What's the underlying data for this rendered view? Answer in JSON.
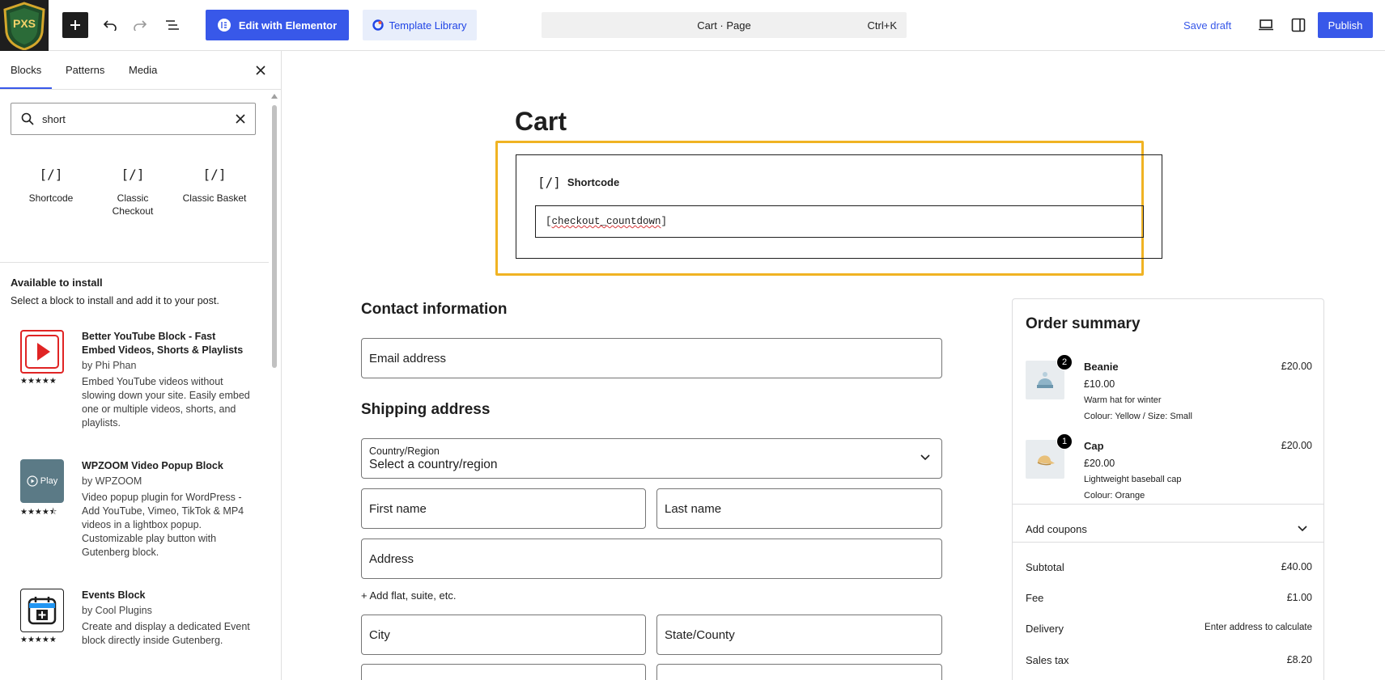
{
  "topbar": {
    "logo_text": "PXS",
    "edit_elementor_label": "Edit with Elementor",
    "template_library_label": "Template Library",
    "command_title": "Cart · Page",
    "command_shortcut": "Ctrl+K",
    "save_draft_label": "Save draft",
    "publish_label": "Publish",
    "accent_color": "#3858e9"
  },
  "sidebar": {
    "tabs": [
      "Blocks",
      "Patterns",
      "Media"
    ],
    "search_value": "short",
    "block_results": [
      {
        "icon": "[/]",
        "label": "Shortcode"
      },
      {
        "icon": "[/]",
        "label": "Classic Checkout"
      },
      {
        "icon": "[/]",
        "label": "Classic Basket"
      }
    ],
    "available_title": "Available to install",
    "available_subtitle": "Select a block to install and add it to your post.",
    "plugins": [
      {
        "name": "Better YouTube Block - Fast Embed Videos, Shorts & Playlists",
        "author": "by Phi Phan",
        "rating": 5,
        "stars": "★★★★★",
        "description": "Embed YouTube videos without slowing down your site. Easily embed one or multiple videos, shorts, and playlists."
      },
      {
        "name": "WPZOOM Video Popup Block",
        "author": "by WPZOOM",
        "rating": 4.5,
        "stars": "★★★★⯪",
        "icon_text": "Play",
        "description": "Video popup plugin for WordPress - Add YouTube, Vimeo, TikTok & MP4 videos in a lightbox popup. Customizable play button with Gutenberg block."
      },
      {
        "name": "Events Block",
        "author": "by Cool Plugins",
        "rating": 5,
        "stars": "★★★★★",
        "description": "Create and display a dedicated Event block directly inside Gutenberg."
      }
    ]
  },
  "canvas": {
    "page_title": "Cart",
    "shortcode_block": {
      "label": "Shortcode",
      "icon": "[/]",
      "value_prefix": "[",
      "value_word": "checkout_countdown",
      "value_suffix": "]"
    },
    "contact_title": "Contact information",
    "email_placeholder": "Email address",
    "shipping_title": "Shipping address",
    "country_label": "Country/Region",
    "country_value": "Select a country/region",
    "first_name": "First name",
    "last_name": "Last name",
    "address": "Address",
    "add_flat": "+ Add flat, suite, etc.",
    "city": "City",
    "state": "State/County"
  },
  "summary": {
    "title": "Order summary",
    "items": [
      {
        "qty": "2",
        "name": "Beanie",
        "total": "£20.00",
        "price": "£10.00",
        "desc": "Warm hat for winter",
        "meta": "Colour: Yellow / Size: Small"
      },
      {
        "qty": "1",
        "name": "Cap",
        "total": "£20.00",
        "price": "£20.00",
        "desc": "Lightweight baseball cap",
        "meta": "Colour: Orange"
      }
    ],
    "coupons_label": "Add coupons",
    "subtotal_label": "Subtotal",
    "subtotal_value": "£40.00",
    "fee_label": "Fee",
    "fee_value": "£1.00",
    "delivery_label": "Delivery",
    "delivery_value": "Enter address to calculate",
    "tax_label": "Sales tax",
    "tax_value": "£8.20"
  }
}
